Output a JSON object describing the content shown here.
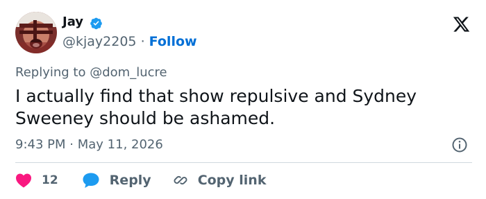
{
  "author": {
    "name": "Jay",
    "handle": "@kjay2205",
    "separator": "·",
    "follow_label": "Follow",
    "verified": true
  },
  "reply_context": {
    "prefix": "Replying to",
    "mention": "@dom_lucre"
  },
  "tweet": {
    "text": "I actually find that show repulsive and Sydney Sweeney should be ashamed.",
    "time": "9:43 PM",
    "separator": "·",
    "date": "May 11, 2026"
  },
  "actions": {
    "like_count": "12",
    "reply_label": "Reply",
    "copy_link_label": "Copy link"
  },
  "colors": {
    "text_primary": "#0f1419",
    "text_secondary": "#536471",
    "link_blue": "#006fd6",
    "verified_blue": "#1d9bf0",
    "like_pink": "#f91880",
    "reply_blue": "#1d9bf0",
    "divider": "#cfd9de"
  },
  "icons": {
    "verified": "verified-badge-icon",
    "brand": "x-logo-icon",
    "info": "info-icon",
    "like": "heart-icon",
    "reply": "speech-bubble-icon",
    "copy": "link-icon"
  }
}
